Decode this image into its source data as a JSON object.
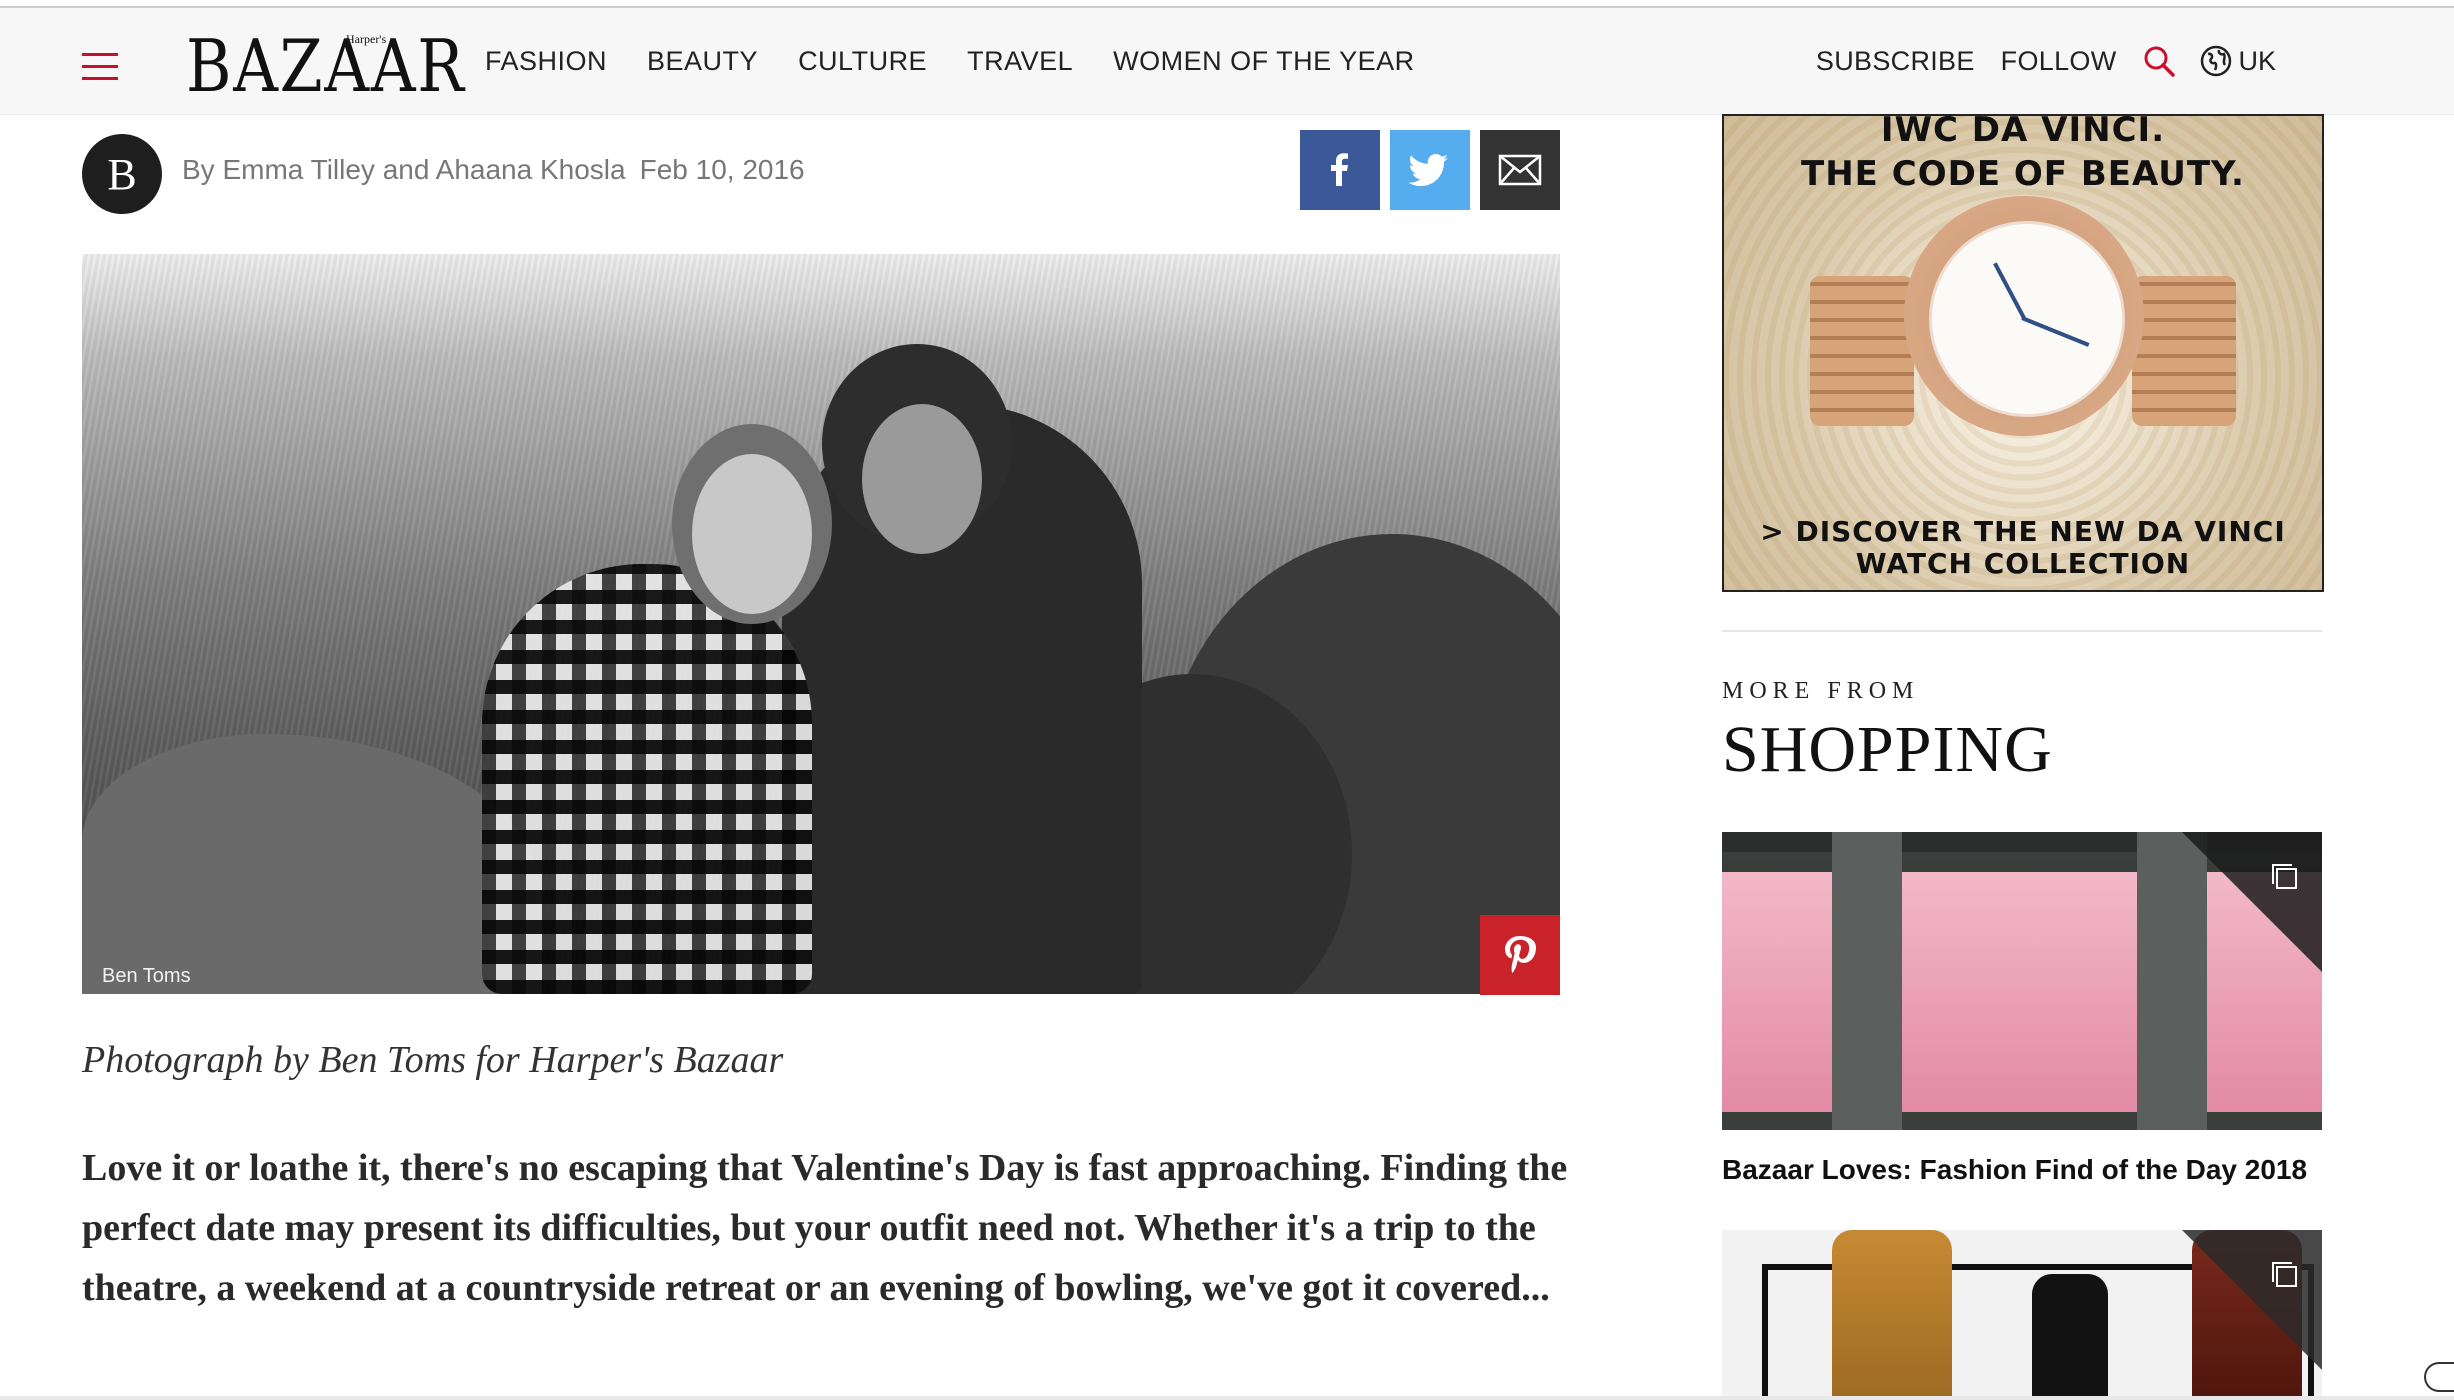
{
  "header": {
    "logo": "BAZAAR",
    "logo_small": "Harper's",
    "nav": [
      "FASHION",
      "BEAUTY",
      "CULTURE",
      "TRAVEL",
      "WOMEN OF THE YEAR"
    ],
    "subscribe": "SUBSCRIBE",
    "follow": "FOLLOW",
    "region": "UK"
  },
  "article": {
    "avatar_letter": "B",
    "author": "By Emma Tilley and Ahaana Khosla",
    "date": "Feb 10, 2016",
    "photo_credit": "Ben Toms",
    "caption": "Photograph by Ben Toms for Harper's Bazaar",
    "intro": "Love it or loathe it, there's no escaping that Valentine's Day is fast approaching. Finding the perfect date may present its difficulties, but your outfit need not. Whether it's a trip to the theatre, a weekend at a countryside retreat or an evening of bowling, we've got it covered..."
  },
  "ad": {
    "headline_1": "IWC DA VINCI.",
    "headline_2": "THE CODE OF BEAUTY.",
    "cta_1": "> DISCOVER THE NEW DA VINCI",
    "cta_2": "WATCH COLLECTION"
  },
  "sidebar": {
    "kicker": "MORE FROM",
    "title": "SHOPPING",
    "cards": [
      {
        "title": "Bazaar Loves: Fashion Find of the Day 2018"
      },
      {
        "title": ""
      }
    ]
  },
  "colors": {
    "accent_red": "#c8102e",
    "facebook": "#3b5998",
    "twitter": "#55acee",
    "email": "#333333",
    "pinterest": "#c92228"
  },
  "icons": [
    "hamburger-icon",
    "search-icon",
    "globe-icon",
    "facebook-icon",
    "twitter-icon",
    "email-icon",
    "pinterest-icon",
    "gallery-icon"
  ]
}
